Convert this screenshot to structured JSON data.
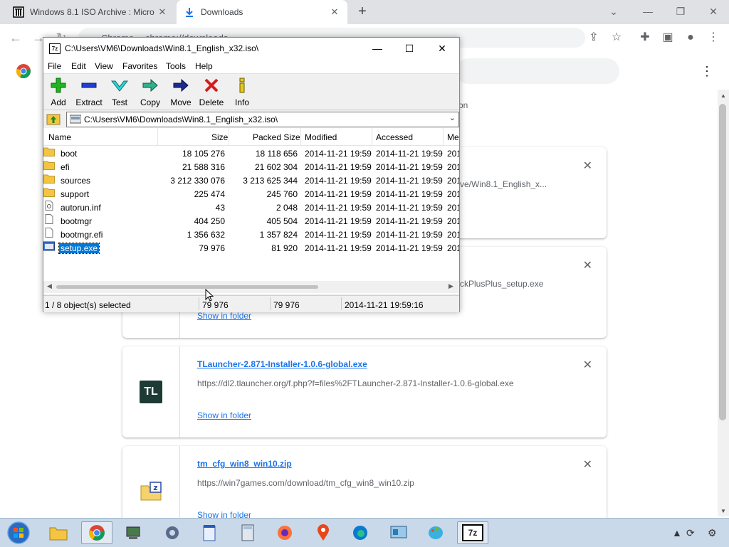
{
  "browser": {
    "tabs": [
      {
        "title": "Windows 8.1 ISO Archive : Micro",
        "active": false
      },
      {
        "title": "Downloads",
        "active": true
      }
    ],
    "omnibox": {
      "scheme": "Chrome",
      "url": "chrome://downloads"
    }
  },
  "downloads_page": {
    "partial_text": "on",
    "items": [
      {
        "url": "ve/Win8.1_English_x..."
      },
      {
        "url": "ckPlusPlus_setup.exe",
        "link": "Show in folder"
      },
      {
        "filename": "TLauncher-2.871-Installer-1.0.6-global.exe",
        "url": "https://dl2.tlauncher.org/f.php?f=files%2FTLauncher-2.871-Installer-1.0.6-global.exe",
        "link": "Show in folder",
        "icon_text": "TL"
      },
      {
        "filename": "tm_cfg_win8_win10.zip",
        "url": "https://win7games.com/download/tm_cfg_win8_win10.zip",
        "link": "Show in folder"
      }
    ]
  },
  "zip_window": {
    "title": "C:\\Users\\VM6\\Downloads\\Win8.1_English_x32.iso\\",
    "menu": [
      "File",
      "Edit",
      "View",
      "Favorites",
      "Tools",
      "Help"
    ],
    "toolbar": [
      "Add",
      "Extract",
      "Test",
      "Copy",
      "Move",
      "Delete",
      "Info"
    ],
    "address": "C:\\Users\\VM6\\Downloads\\Win8.1_English_x32.iso\\",
    "columns": [
      "Name",
      "Size",
      "Packed Size",
      "Modified",
      "Accessed",
      "Me"
    ],
    "rows": [
      {
        "name": "boot",
        "size": "18 105 276",
        "packed": "18 118 656",
        "modified": "2014-11-21 19:59",
        "accessed": "2014-11-21 19:59",
        "me": "201",
        "type": "folder"
      },
      {
        "name": "efi",
        "size": "21 588 316",
        "packed": "21 602 304",
        "modified": "2014-11-21 19:59",
        "accessed": "2014-11-21 19:59",
        "me": "201",
        "type": "folder"
      },
      {
        "name": "sources",
        "size": "3 212 330 076",
        "packed": "3 213 625 344",
        "modified": "2014-11-21 19:59",
        "accessed": "2014-11-21 19:59",
        "me": "201",
        "type": "folder"
      },
      {
        "name": "support",
        "size": "225 474",
        "packed": "245 760",
        "modified": "2014-11-21 19:59",
        "accessed": "2014-11-21 19:59",
        "me": "201",
        "type": "folder"
      },
      {
        "name": "autorun.inf",
        "size": "43",
        "packed": "2 048",
        "modified": "2014-11-21 19:59",
        "accessed": "2014-11-21 19:59",
        "me": "201",
        "type": "inf"
      },
      {
        "name": "bootmgr",
        "size": "404 250",
        "packed": "405 504",
        "modified": "2014-11-21 19:59",
        "accessed": "2014-11-21 19:59",
        "me": "201",
        "type": "file"
      },
      {
        "name": "bootmgr.efi",
        "size": "1 356 632",
        "packed": "1 357 824",
        "modified": "2014-11-21 19:59",
        "accessed": "2014-11-21 19:59",
        "me": "201",
        "type": "file"
      },
      {
        "name": "setup.exe",
        "size": "79 976",
        "packed": "81 920",
        "modified": "2014-11-21 19:59",
        "accessed": "2014-11-21 19:59",
        "me": "201",
        "type": "exe",
        "selected": true
      }
    ],
    "status": {
      "selection": "1 / 8 object(s) selected",
      "size": "79 976",
      "packed": "79 976",
      "date": "2014-11-21 19:59:16"
    }
  },
  "taskbar": {
    "items": [
      "start-orb",
      "file-explorer",
      "chrome",
      "device-manager",
      "settings",
      "notepad",
      "calculator",
      "firefox",
      "maps",
      "edge",
      "control-panel",
      "paint",
      "7-zip"
    ],
    "active": "7-zip"
  },
  "colors": {
    "accent": "#1a73e8",
    "selection": "#0078d7",
    "taskbar": "#c9d9ea"
  }
}
